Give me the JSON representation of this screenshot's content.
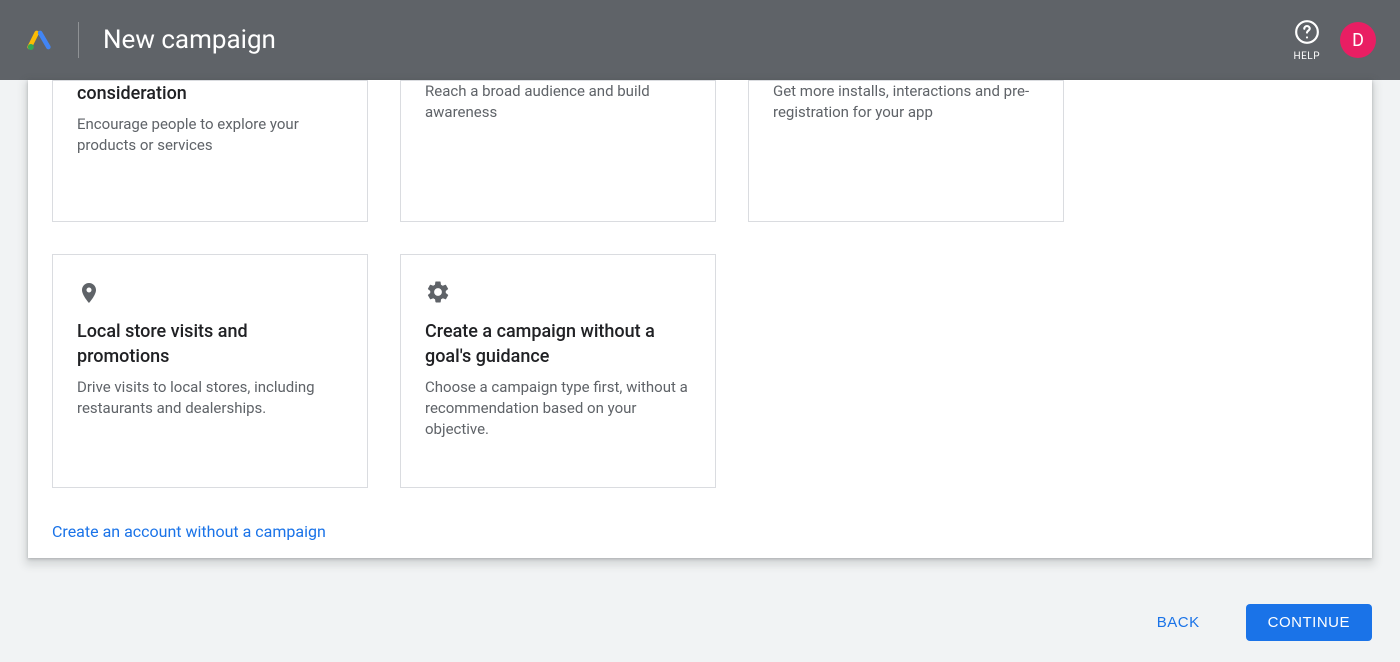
{
  "header": {
    "title": "New campaign",
    "help_label": "HELP",
    "avatar_initial": "D"
  },
  "cards": {
    "row1": [
      {
        "title": "consideration",
        "desc": "Encourage people to explore your products or services"
      },
      {
        "title": "",
        "desc": "Reach a broad audience and build awareness"
      },
      {
        "title": "",
        "desc": "Get more installs, interactions and pre-registration for your app"
      }
    ],
    "row2": [
      {
        "icon": "pin",
        "title": "Local store visits and promotions",
        "desc": "Drive visits to local stores, including restaurants and dealerships."
      },
      {
        "icon": "gear",
        "title": "Create a campaign without a goal's guidance",
        "desc": "Choose a campaign type first, without a recommendation based on your objective."
      }
    ]
  },
  "link": {
    "label": "Create an account without a campaign"
  },
  "footer": {
    "back": "BACK",
    "continue": "CONTINUE"
  }
}
